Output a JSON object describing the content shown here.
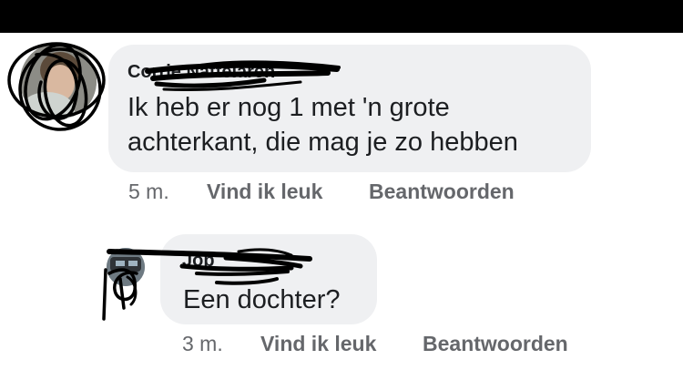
{
  "comments": [
    {
      "author": "Corrie Nattelaren",
      "lines": [
        "Ik heb er nog 1 met 'n grote",
        "achterkant, die mag je zo hebben"
      ],
      "time": "5 m.",
      "like_label": "Vind ik leuk",
      "reply_label": "Beantwoorden"
    },
    {
      "author": "Job",
      "lines": [
        "Een dochter?"
      ],
      "time": "3 m.",
      "like_label": "Vind ik leuk",
      "reply_label": "Beantwoorden"
    }
  ],
  "colors": {
    "bubble_bg": "#eff0f2",
    "text": "#1c1e21",
    "meta_text": "#65676b",
    "top_bar": "#000000",
    "scribble": "#000000"
  }
}
